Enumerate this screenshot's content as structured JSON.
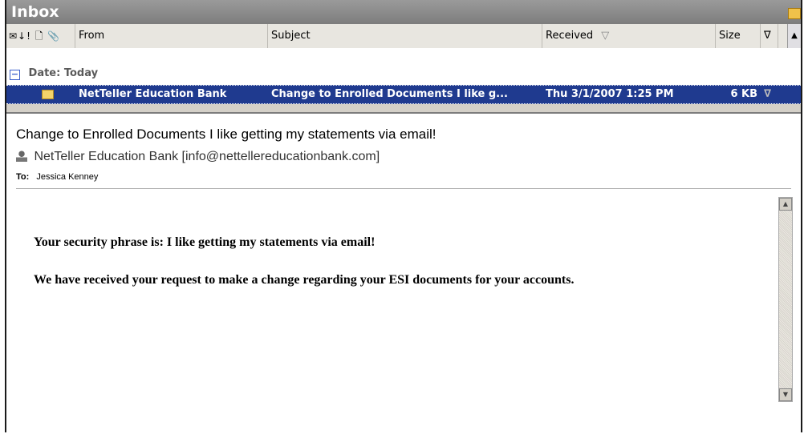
{
  "window": {
    "title": "Inbox"
  },
  "columns": {
    "icons": "✉↓! 🗋 📎",
    "from": "From",
    "subject": "Subject",
    "received": "Received",
    "received_sort": "▽",
    "size": "Size",
    "flag": "∇",
    "scroll_up": "▲"
  },
  "group": {
    "toggle": "−",
    "label": "Date: Today"
  },
  "message": {
    "from": "NetTeller Education Bank",
    "subject": "Change to Enrolled Documents I like g...",
    "received": "Thu 3/1/2007 1:25 PM",
    "size": "6 KB",
    "flag": "∇"
  },
  "preview": {
    "subject": "Change to Enrolled Documents I like getting my     statements via email!",
    "sender": "NetTeller Education Bank [info@nettellereducationbank.com]",
    "to_label": "To:",
    "to_value": "Jessica Kenney",
    "body_line1": "Your security phrase is: I like getting my statements via email!",
    "body_line2": "We have received your request to make a change regarding your ESI documents for your accounts.",
    "scroll_up": "▲",
    "scroll_down": "▼"
  }
}
